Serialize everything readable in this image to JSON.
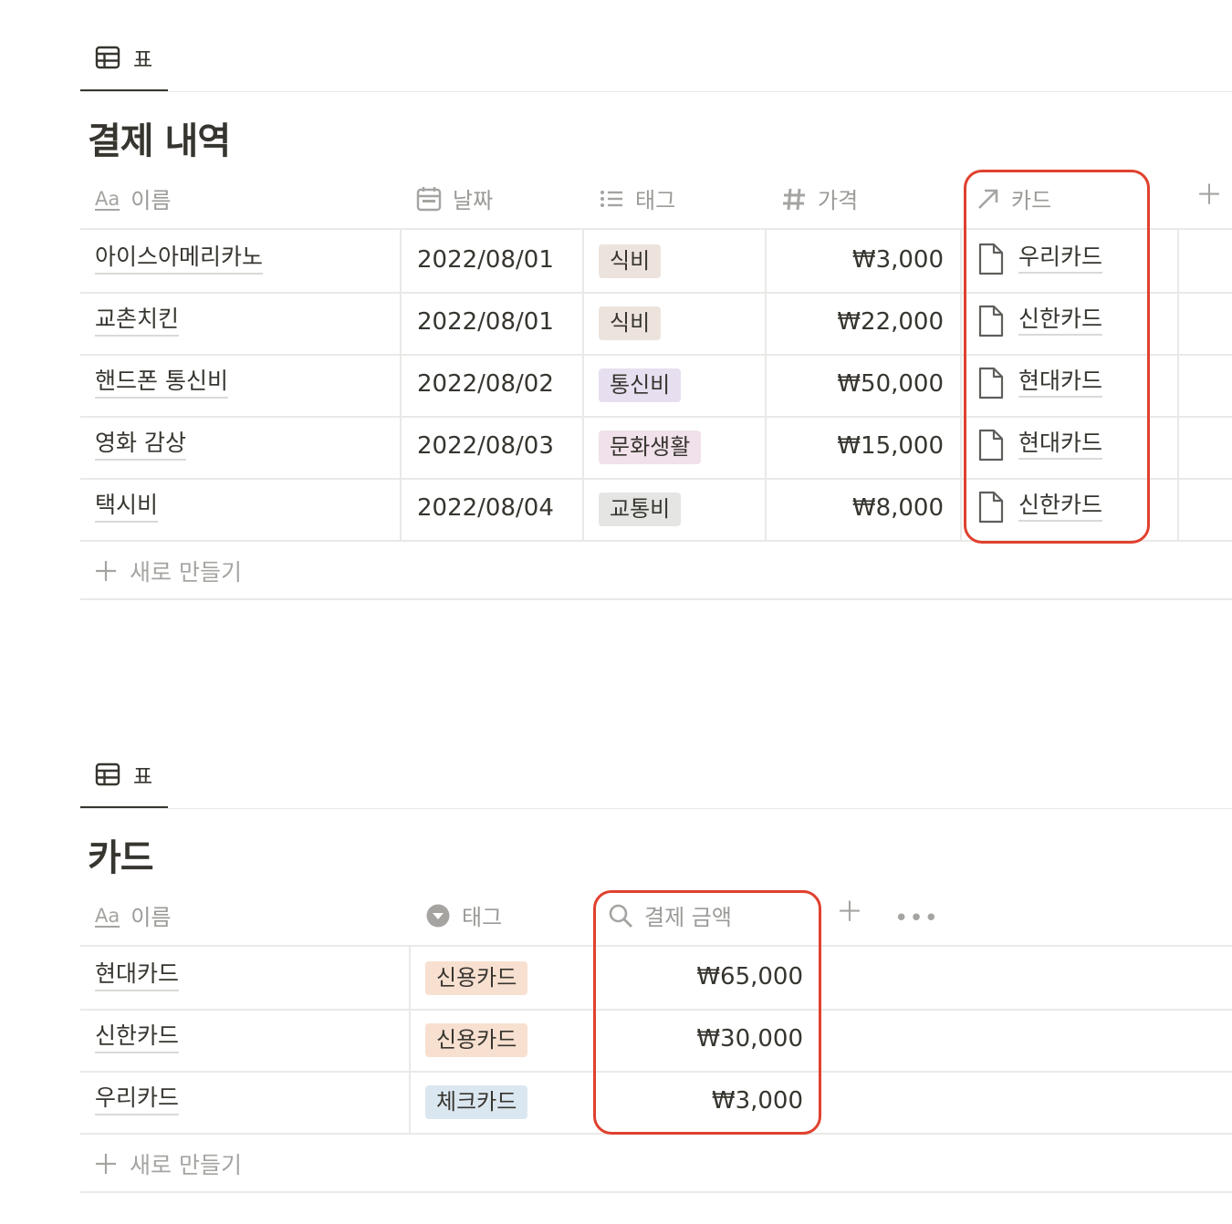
{
  "colors": {
    "text": "#37352f",
    "muted": "#9b9a97",
    "divider": "#e9e9e7",
    "highlight": "#e0412e"
  },
  "payments": {
    "view_tab": {
      "label": "표",
      "icon": "table-icon"
    },
    "title": "결제 내역",
    "columns": [
      {
        "label": "이름",
        "icon": "aa-text-icon"
      },
      {
        "label": "날짜",
        "icon": "calendar-icon"
      },
      {
        "label": "태그",
        "icon": "list-icon"
      },
      {
        "label": "가격",
        "icon": "hash-icon"
      },
      {
        "label": "카드",
        "icon": "relation-arrow-icon"
      }
    ],
    "rows": [
      {
        "name": "아이스아메리카노",
        "date": "2022/08/01",
        "tag": "식비",
        "tag_color": "#ede3dd",
        "price": "₩3,000",
        "card": "우리카드"
      },
      {
        "name": "교촌치킨",
        "date": "2022/08/01",
        "tag": "식비",
        "tag_color": "#ede3dd",
        "price": "₩22,000",
        "card": "신한카드"
      },
      {
        "name": "핸드폰 통신비",
        "date": "2022/08/02",
        "tag": "통신비",
        "tag_color": "#e7dff0",
        "price": "₩50,000",
        "card": "현대카드"
      },
      {
        "name": "영화 감상",
        "date": "2022/08/03",
        "tag": "문화생활",
        "tag_color": "#f0e1ea",
        "price": "₩15,000",
        "card": "현대카드"
      },
      {
        "name": "택시비",
        "date": "2022/08/04",
        "tag": "교통비",
        "tag_color": "#e5e5e3",
        "price": "₩8,000",
        "card": "신한카드"
      }
    ],
    "new_row_label": "새로 만들기"
  },
  "cards": {
    "view_tab": {
      "label": "표",
      "icon": "table-icon"
    },
    "title": "카드",
    "columns": [
      {
        "label": "이름",
        "icon": "aa-text-icon"
      },
      {
        "label": "태그",
        "icon": "select-dropdown-icon"
      },
      {
        "label": "결제 금액",
        "icon": "search-icon"
      }
    ],
    "rows": [
      {
        "name": "현대카드",
        "tag": "신용카드",
        "tag_color": "#f7e0d0",
        "amount": "₩65,000"
      },
      {
        "name": "신한카드",
        "tag": "신용카드",
        "tag_color": "#f7e0d0",
        "amount": "₩30,000"
      },
      {
        "name": "우리카드",
        "tag": "체크카드",
        "tag_color": "#dbe7f0",
        "amount": "₩3,000"
      }
    ],
    "new_row_label": "새로 만들기"
  }
}
